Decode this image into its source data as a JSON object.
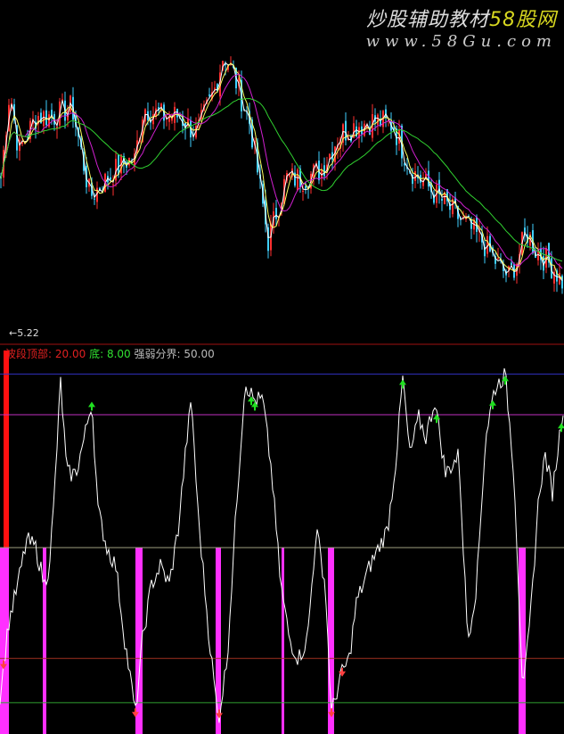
{
  "watermark": {
    "title_a": "炒股辅助教材",
    "title_b": "58股网",
    "url": "www.58Gu.com"
  },
  "price_panel": {
    "low_label": "5.22"
  },
  "indicator_legend": {
    "top_label": "波段顶部:",
    "top_value": "20.00",
    "bottom_label": "底:",
    "bottom_value": "8.00",
    "split_label": "强弱分界:",
    "split_value": "50.00"
  },
  "colors": {
    "up": "#ff3030",
    "down": "#40d0ff",
    "ma_short": "#ffffff",
    "ma_mid": "#ffff60",
    "ma_long": "#d020d0",
    "ma_longer": "#30d030",
    "bar": "#ff30ff",
    "signal_top": "#20e020",
    "signal_bottom": "#ff4040"
  },
  "chart_data": [
    {
      "type": "line",
      "title": "price (candles + moving averages)",
      "x": [
        0,
        10,
        20,
        40,
        60,
        80,
        100,
        120,
        140,
        150,
        160,
        180,
        200,
        220,
        240,
        250,
        260,
        280,
        300,
        320,
        340,
        360,
        380,
        400,
        420,
        440,
        460,
        480,
        500,
        520,
        540,
        560,
        570,
        580,
        590,
        600,
        620,
        633
      ],
      "y": [
        200,
        300,
        230,
        270,
        270,
        280,
        180,
        200,
        220,
        220,
        280,
        270,
        270,
        250,
        300,
        340,
        320,
        260,
        130,
        200,
        200,
        210,
        250,
        260,
        265,
        260,
        210,
        190,
        170,
        150,
        130,
        100,
        90,
        110,
        140,
        120,
        100,
        80
      ]
    },
    {
      "type": "line",
      "title": "oscillator",
      "ylim": [
        0,
        100
      ],
      "levels": [
        97,
        86,
        50,
        20,
        8
      ],
      "x": [
        0,
        10,
        20,
        30,
        40,
        50,
        55,
        60,
        68,
        75,
        85,
        95,
        103,
        110,
        120,
        130,
        140,
        152,
        160,
        170,
        180,
        190,
        200,
        210,
        215,
        222,
        235,
        245,
        255,
        265,
        275,
        285,
        295,
        305,
        315,
        325,
        335,
        345,
        355,
        365,
        372,
        382,
        392,
        400,
        415,
        425,
        435,
        445,
        452,
        460,
        470,
        478,
        488,
        500,
        515,
        525,
        535,
        545,
        555,
        567,
        577,
        587,
        595,
        605,
        612,
        620,
        633
      ],
      "y": [
        10,
        30,
        40,
        52,
        50,
        40,
        45,
        60,
        95,
        70,
        70,
        80,
        90,
        60,
        50,
        45,
        25,
        5,
        25,
        40,
        45,
        40,
        55,
        80,
        90,
        60,
        25,
        3,
        20,
        60,
        95,
        90,
        90,
        70,
        40,
        25,
        20,
        25,
        55,
        40,
        5,
        15,
        20,
        35,
        45,
        50,
        55,
        75,
        96,
        75,
        85,
        80,
        90,
        70,
        75,
        25,
        40,
        80,
        93,
        97,
        70,
        10,
        30,
        65,
        75,
        65,
        90
      ],
      "bars": [
        [
          0,
          10
        ],
        [
          48,
          52
        ],
        [
          152,
          160
        ],
        [
          242,
          248
        ],
        [
          316,
          319
        ],
        [
          368,
          375
        ],
        [
          582,
          590
        ]
      ],
      "top_signals": [
        103,
        282,
        286,
        452,
        490,
        553,
        567,
        630
      ],
      "bottom_signals": [
        4,
        152,
        246,
        372,
        384
      ]
    }
  ]
}
